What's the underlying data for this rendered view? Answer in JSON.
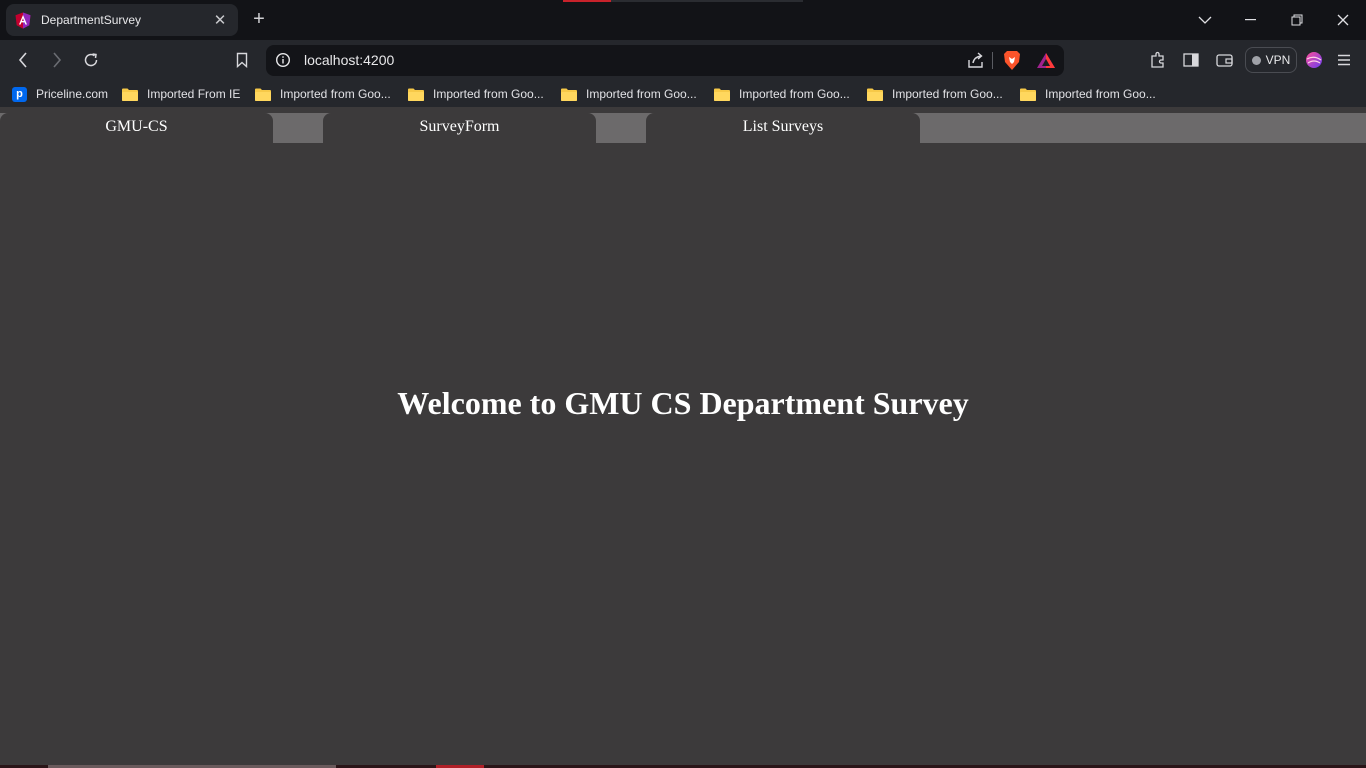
{
  "browser": {
    "tab": {
      "title": "DepartmentSurvey",
      "favicon": "angular-icon"
    },
    "url": "localhost:4200",
    "vpn_label": "VPN",
    "bookmarks": [
      {
        "label": "Priceline.com",
        "icon": "priceline-icon"
      },
      {
        "label": "Imported From IE",
        "icon": "folder-icon"
      },
      {
        "label": "Imported from Goo...",
        "icon": "folder-icon"
      },
      {
        "label": "Imported from Goo...",
        "icon": "folder-icon"
      },
      {
        "label": "Imported from Goo...",
        "icon": "folder-icon"
      },
      {
        "label": "Imported from Goo...",
        "icon": "folder-icon"
      },
      {
        "label": "Imported from Goo...",
        "icon": "folder-icon"
      },
      {
        "label": "Imported from Goo...",
        "icon": "folder-icon"
      }
    ]
  },
  "app": {
    "nav": [
      {
        "label": "GMU-CS"
      },
      {
        "label": "SurveyForm"
      },
      {
        "label": "List Surveys"
      }
    ],
    "welcome": "Welcome to GMU CS Department Survey"
  },
  "colors": {
    "page_background": "#3c3a3b",
    "nav_strip": "#6c6a6b",
    "text": "#ffffff"
  }
}
